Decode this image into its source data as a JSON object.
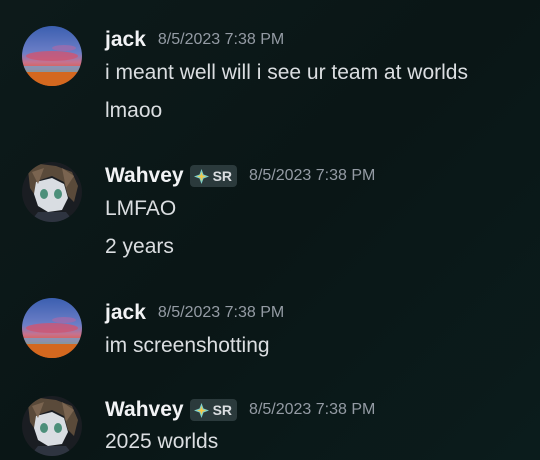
{
  "messages": [
    {
      "author": "jack",
      "timestamp": "8/5/2023 7:38 PM",
      "avatar": "sunset-avatar",
      "lines": [
        "i meant well will i see ur team at worlds",
        "lmaoo"
      ]
    },
    {
      "author": "Wahvey",
      "timestamp": "8/5/2023 7:38 PM",
      "avatar": "anime-avatar",
      "tag": "SR",
      "tag_icon": "sparkle-icon",
      "lines": [
        "LMFAO",
        "2 years"
      ]
    },
    {
      "author": "jack",
      "timestamp": "8/5/2023 7:38 PM",
      "avatar": "sunset-avatar",
      "lines": [
        "im screenshotting"
      ]
    },
    {
      "author": "Wahvey",
      "timestamp": "8/5/2023 7:38 PM",
      "avatar": "anime-avatar",
      "tag": "SR",
      "tag_icon": "sparkle-icon",
      "lines": [
        "2025 worlds"
      ]
    }
  ],
  "colors": {
    "background": "#0d1a1a",
    "username": "#f2f3f5",
    "timestamp": "#949ba4",
    "message_text": "#dbdee1",
    "tag_background": "#2b3a3c"
  }
}
